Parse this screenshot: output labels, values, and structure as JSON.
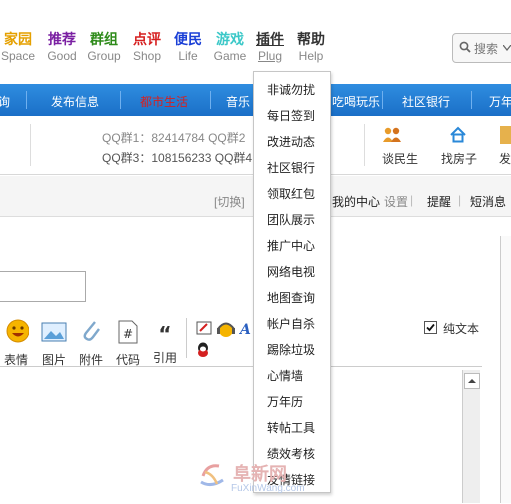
{
  "nav": {
    "items": [
      {
        "zh": "家园",
        "en": "Space",
        "color": "#e5a000"
      },
      {
        "zh": "推荐",
        "en": "Good",
        "color": "#7a1fa2"
      },
      {
        "zh": "群组",
        "en": "Group",
        "color": "#2e8b1a"
      },
      {
        "zh": "点评",
        "en": "Shop",
        "color": "#d62020"
      },
      {
        "zh": "便民",
        "en": "Life",
        "color": "#1a3fd6"
      },
      {
        "zh": "游戏",
        "en": "Game",
        "color": "#3cc8c8"
      },
      {
        "zh": "插件",
        "en": "Plug",
        "color": "#333333"
      },
      {
        "zh": "帮助",
        "en": "Help",
        "color": "#333333"
      }
    ],
    "search_label": "搜索"
  },
  "bluebar": {
    "items": [
      "询",
      "发布信息",
      "都市生活",
      "音乐",
      "吃喝玩乐",
      "社区银行",
      "万年"
    ]
  },
  "info": {
    "qq_line1": "QQ群1：82414784 QQ群2",
    "qq_line2": "QQ群3：108156233 QQ群4",
    "icons": [
      "谈民生",
      "找房子",
      "发"
    ]
  },
  "userbar": {
    "switch": "[切换]",
    "center": "我的中心",
    "settings": "设置",
    "remind": "提醒",
    "sms": "短消息"
  },
  "toolbar": {
    "buttons": [
      "表情",
      "图片",
      "附件",
      "代码",
      "引用"
    ],
    "plaintext_label": "纯文本",
    "plaintext_checked": true
  },
  "plugin_menu": {
    "items": [
      "非诚勿扰",
      "每日签到",
      "改进动态",
      "社区银行",
      "领取红包",
      "团队展示",
      "推广中心",
      "网络电视",
      "地图查询",
      "帐户自杀",
      "踢除垃圾",
      "心情墙",
      "万年历",
      "转帖工具",
      "绩效考核",
      "友情链接"
    ]
  },
  "watermark": {
    "text_zh": "阜新网",
    "text_en": "FuXinWang.com"
  }
}
